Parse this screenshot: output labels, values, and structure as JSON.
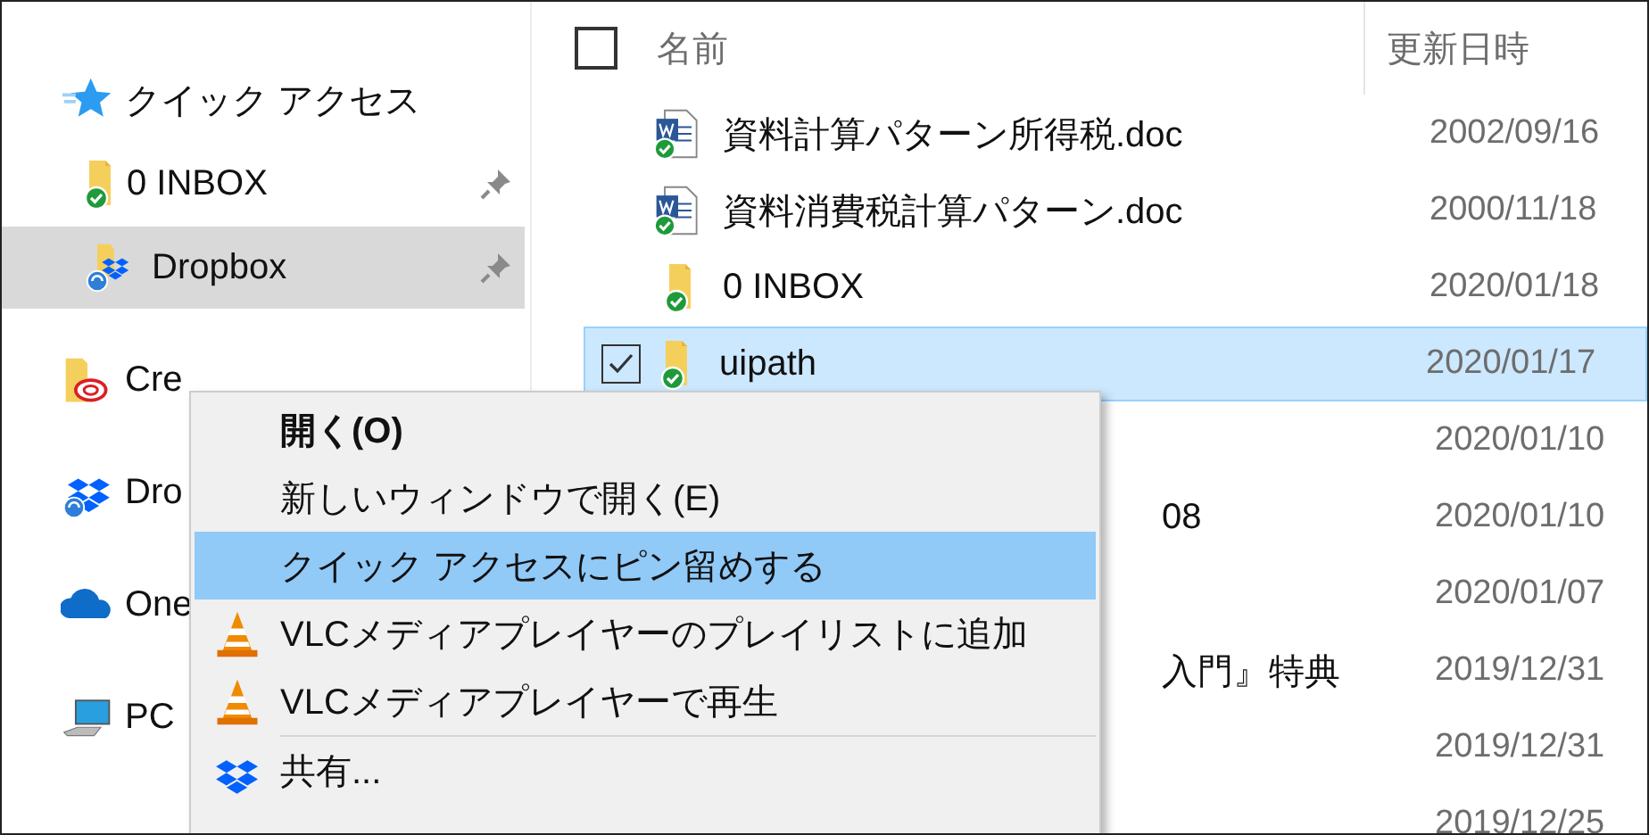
{
  "navigation": {
    "items": [
      {
        "label": "クイック アクセス",
        "kind": "quick",
        "selected": false,
        "children": [
          {
            "label": "0 INBOX",
            "kind": "folder",
            "pinned": true,
            "selected": false
          },
          {
            "label": "Dropbox",
            "kind": "dropbox-folder",
            "pinned": true,
            "selected": true
          }
        ]
      },
      {
        "label": "Cre",
        "kind": "creative-cloud",
        "selected": false
      },
      {
        "label": "Dro",
        "kind": "dropbox",
        "selected": false
      },
      {
        "label": "One",
        "kind": "onedrive",
        "selected": false
      },
      {
        "label": "PC",
        "kind": "pc",
        "selected": false
      }
    ]
  },
  "file_list": {
    "select_all_checked": false,
    "columns": [
      "名前",
      "更新日時"
    ],
    "rows": [
      {
        "name": "資料計算パターン所得税.doc",
        "kind": "word",
        "modified": "2002/09/16",
        "selected": false
      },
      {
        "name": "資料消費税計算パターン.doc",
        "kind": "word",
        "modified": "2000/11/18",
        "selected": false
      },
      {
        "name": "0 INBOX",
        "kind": "folder",
        "modified": "2020/01/18",
        "selected": false
      },
      {
        "name": "uipath",
        "kind": "folder",
        "modified": "2020/01/17",
        "selected": true
      },
      {
        "kind": "covered",
        "modified": "2020/01/10",
        "selected": false
      },
      {
        "name": "08",
        "kind": "covered",
        "modified": "2020/01/10",
        "selected": false
      },
      {
        "kind": "covered",
        "modified": "2020/01/07",
        "selected": false
      },
      {
        "name": "入門』特典",
        "kind": "covered",
        "modified": "2019/12/31",
        "selected": false
      },
      {
        "kind": "covered",
        "modified": "2019/12/31",
        "selected": false
      },
      {
        "kind": "covered",
        "modified": "2019/12/25",
        "selected": false
      }
    ]
  },
  "context_menu": {
    "items": [
      {
        "label": "開く(O)",
        "kind": "default",
        "selected": false
      },
      {
        "label": "新しいウィンドウで開く(E)",
        "kind": "plain",
        "selected": false
      },
      {
        "label": "クイック アクセスにピン留めする",
        "kind": "plain",
        "selected": true
      },
      {
        "label": "VLCメディアプレイヤーのプレイリストに追加",
        "kind": "vlc",
        "selected": false
      },
      {
        "label": "VLCメディアプレイヤーで再生",
        "kind": "vlc",
        "selected": false
      },
      {
        "kind": "separator"
      },
      {
        "label": "共有...",
        "kind": "dropbox",
        "selected": false
      }
    ]
  }
}
